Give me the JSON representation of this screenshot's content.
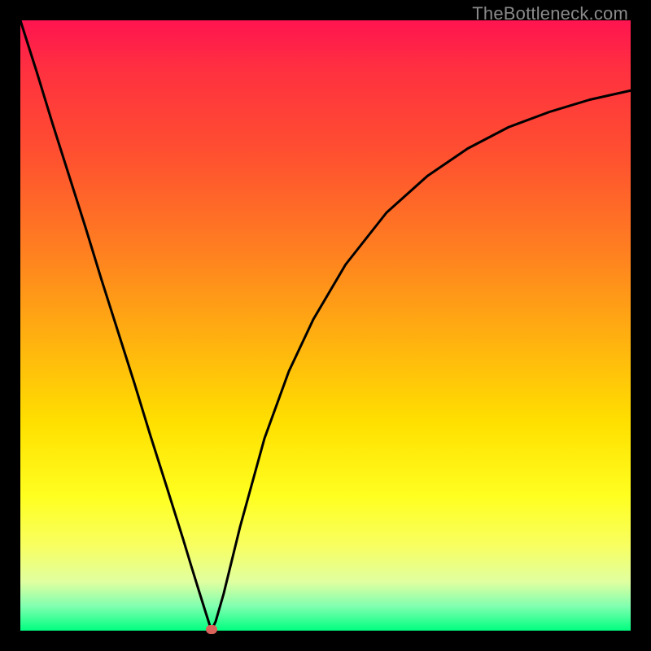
{
  "watermark": "TheBottleneck.com",
  "colors": {
    "background": "#000000",
    "curve": "#000000",
    "marker": "#d9635a"
  },
  "chart_data": {
    "type": "line",
    "title": "",
    "xlabel": "",
    "ylabel": "",
    "xlim": [
      0,
      100
    ],
    "ylim": [
      0,
      100
    ],
    "grid": false,
    "legend": false,
    "annotations": [
      "TheBottleneck.com"
    ],
    "series": [
      {
        "name": "bottleneck-curve",
        "x": [
          0,
          2.7,
          5.3,
          8.0,
          10.7,
          13.3,
          16.0,
          18.7,
          21.3,
          24.0,
          26.7,
          28.0,
          29.3,
          30.3,
          31.0,
          31.3,
          32.0,
          33.3,
          36.0,
          40.0,
          44.0,
          48.0,
          53.3,
          60.0,
          66.7,
          73.3,
          80.0,
          86.7,
          93.3,
          100.0
        ],
        "values": [
          100,
          91.5,
          83.0,
          74.5,
          66.0,
          57.5,
          49.0,
          40.5,
          32.0,
          23.5,
          14.9,
          10.6,
          6.4,
          3.2,
          1.0,
          0.0,
          1.5,
          6.0,
          17.0,
          31.5,
          42.5,
          51.0,
          60.0,
          68.5,
          74.5,
          79.0,
          82.5,
          85.0,
          87.0,
          88.5
        ]
      }
    ],
    "marker": {
      "x": 31.3,
      "y": 0.3
    }
  }
}
